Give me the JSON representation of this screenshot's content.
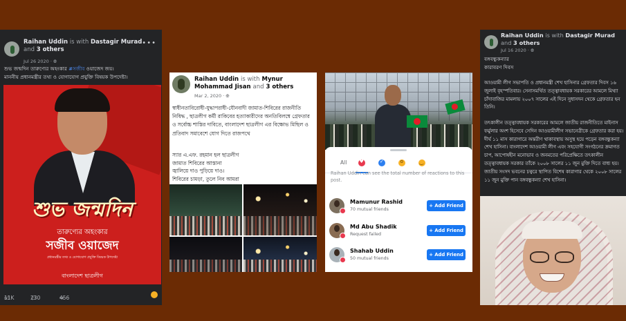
{
  "panel1": {
    "author": "Raihan Uddin",
    "with_word": "is with",
    "tagged": "Dastagir Murad",
    "and_word": "and",
    "others": "3 others",
    "date": "Jul 26 2020 · ",
    "caption_line1_pre": "শুভ জন্মদিন তারুণ্যের অহংকার ",
    "caption_hashtag": "#সজীব",
    "caption_line1_post": " ওয়াজেদ জয়।",
    "caption_line2": "মাননীয় প্রধানমন্ত্রীর তথ্য ও যোগাযোগ প্রযুক্তি বিষয়ক উপদেষ্টা।",
    "poster_greeting": "শুভ জন্মদিন",
    "poster_sub1": "তারুণ্যের অহংকার",
    "poster_name": "সজীব ওয়াজেদ",
    "poster_sub3": "প্রধানমন্ত্রীর তথ্য ও যোগাযোগ প্রযুক্তি বিষয়ক উপদেষ্টা",
    "poster_org": "বাংলাদেশ ছাত্রলীগ",
    "likes": "11K",
    "comments": "230",
    "shares": "456"
  },
  "panel2": {
    "author": "Raihan Uddin",
    "with_word": "is with",
    "tagged": "Mynur Mohammad Jisan",
    "and_word": "and",
    "others": "3 others",
    "date": "Mar 2, 2020 · ",
    "body": "স্বাধীনতাবিরোধী-যুদ্ধাপরাধী-যৌনবাদী জামাত-শিবিরের রাজনীতি নিষিদ্ধ , ছাত্রলীগ কর্মী রাকিবের হত্যাকারীদের অনতিবিলম্বে গ্রেফতার ও সর্বোচ্চ শাস্তির দাবিতে, বাংলাদেশ ছাত্রলীগ এর বিক্ষোভ মিছিল ও প্রতিবাদ সমাবেশে যোগ দিতে রাজপথে",
    "poem": [
      "স্যার এ.এফ. রহমান হল ছাত্রলীগ",
      "জামাত শিবিরের আস্তানা",
      "জ্বালিয়ে দাও পুড়িয়ে দাও।",
      "শিবিরের চামড়া, তুলে নিব আমরা"
    ]
  },
  "panel3": {
    "tabs": [
      "All"
    ],
    "note": "Raihan Uddin can see the total number of reactions to this post.",
    "people": [
      {
        "name": "Mamunur Rashid",
        "sub": "70 mutual friends",
        "button": "Add Friend"
      },
      {
        "name": "Md Abu Shadik",
        "sub": "Request failed",
        "button": "Add Friend"
      },
      {
        "name": "Shahab Uddin",
        "sub": "50 mutual friends",
        "button": "Add Friend"
      }
    ]
  },
  "panel4": {
    "author": "Raihan Uddin",
    "with_word": "is with",
    "tagged": "Dastagir Murad",
    "and_word": "and",
    "others": "3 others",
    "date": "Jul 16 2020 · ",
    "title1": "বঙ্গবন্ধুকন্যার",
    "title2": "কারাবরণ দিবস",
    "para1": "আওয়ামী লীগ সভাপতি ও প্রধানমন্ত্রী শেখ হাসিনার গ্রেফতার দিবস ১৬ জুলাই বৃহস্পতিবার। সেনাসমর্থিত তত্ত্বাবধায়ক সরকারের আমলে মিথ্যা চাঁদাবাজির মামলায় ২০০৭ সালের এই দিনে সুধাসদন থেকে গ্রেফতার হন তিনি।",
    "para2": "তৎকালীন তত্ত্বাবধায়ক সরকারের আমলে জাতীয় রাজনীতিতে মাইনাস ফর্মুলার অংশ হিসেবে সেদিন আওয়ামীলীগ সভানেত্রীকে গ্রেফতার করা হয়। দীর্ঘ ১১ মাস কারাগারে অন্তরীণ থাকাবস্থায় অসুস্থ হয়ে পড়েন বঙ্গবন্ধুকন্যা শেখ হাসিনা। বাংলাদেশ আওয়ামী লীগ এবং সহযোগী সংগঠনের ক্রমাগত চাপ, আপোষহীন মনোভাব ও জনমতের পরিপ্রেক্ষিতে তৎকালীন তত্ত্বাবধায়ক সরকার তাঁকে ২০০৮ সালের ১১ জুন মুক্তি দিতে বাধ্য হয়। জাতীয় সংসদ ভবনের চত্বরে স্থাপিত বিশেষ কারাগার থেকে ২০০৮ সালের ১১ জুন মুক্তি পান বঙ্গবন্ধুকন্যা শেখ হাসিনা।"
  },
  "colors": {
    "background": "#6b2b04",
    "dark_card": "#232426",
    "fb_blue": "#1877f2",
    "poster_red": "#cc1f1d"
  },
  "icons": [
    "globe-icon",
    "more-icon",
    "like-icon",
    "comment-icon",
    "share-icon",
    "love-reaction-icon",
    "like-reaction-icon",
    "wow-reaction-icon",
    "care-reaction-icon",
    "add-friend-icon"
  ]
}
